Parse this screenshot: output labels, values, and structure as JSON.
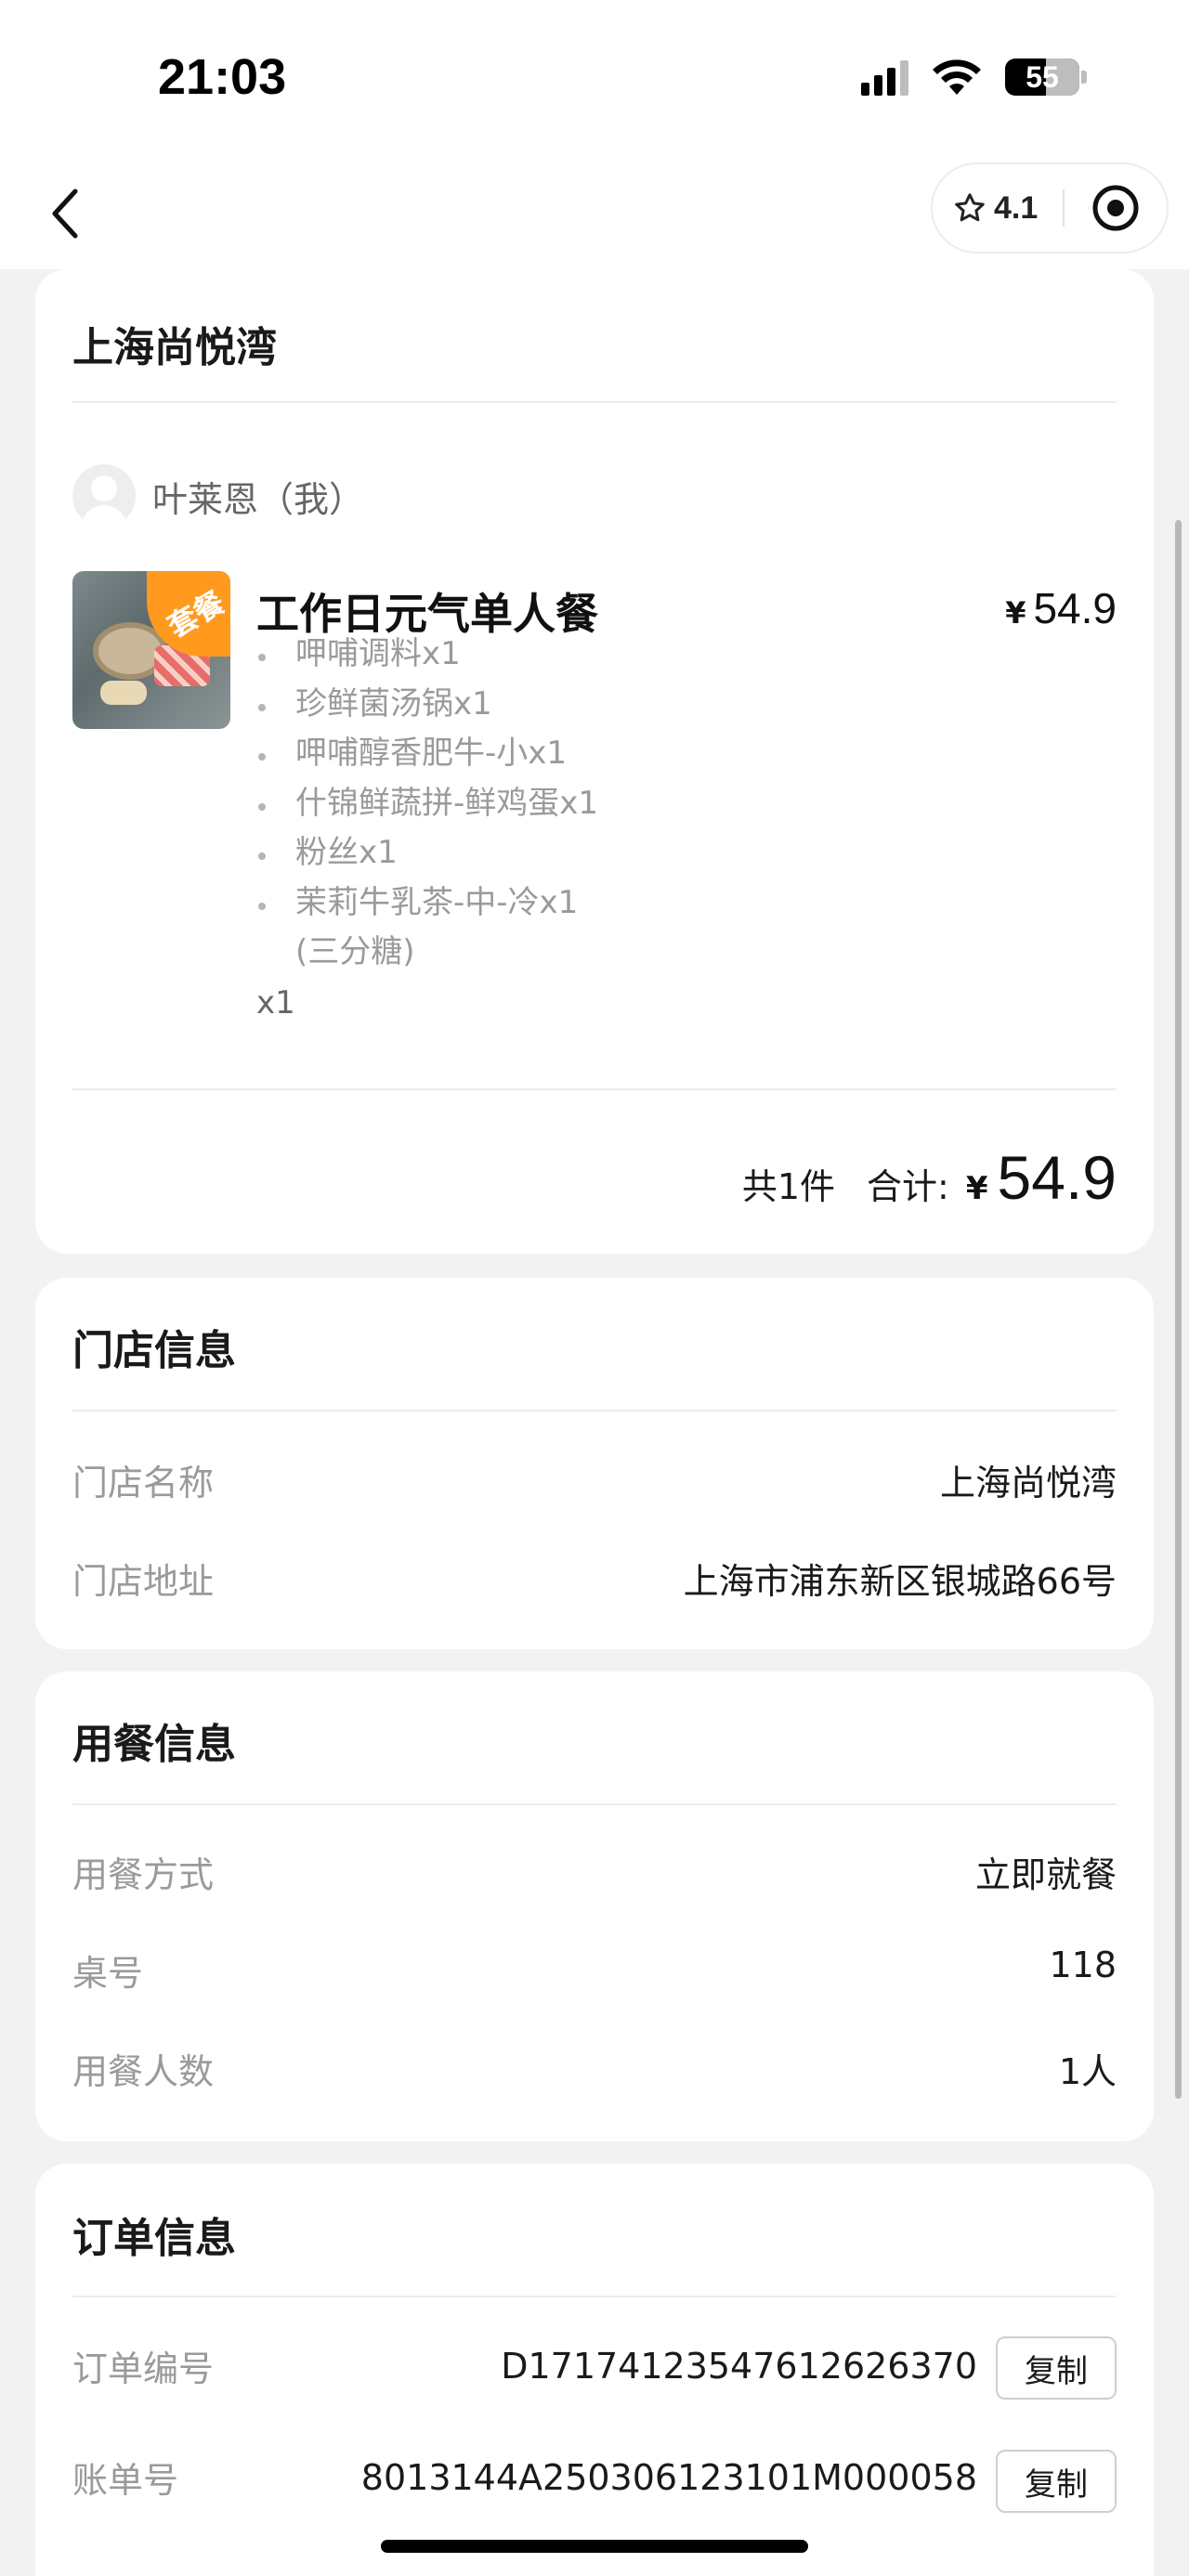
{
  "status_bar": {
    "time": "21:03",
    "battery": "55"
  },
  "nav": {
    "rating": "4.1",
    "back_icon": "chevron-left-icon",
    "star_icon": "star-outline-icon",
    "target_icon": "target-icon"
  },
  "order": {
    "store_title": "上海尚悦湾",
    "user": "叶莱恩（我）",
    "product": {
      "badge": "套餐",
      "name": "工作日元气单人餐",
      "currency": "¥",
      "price": "54.9",
      "items": [
        "呷哺调料x1",
        "珍鲜菌汤锅x1",
        "呷哺醇香肥牛-小x1",
        "什锦鲜蔬拼-鲜鸡蛋x1",
        "粉丝x1",
        "茉莉牛乳茶-中-冷x1"
      ],
      "last_item_note": "(三分糖)",
      "quantity": "x1"
    },
    "total": {
      "count": "共1件",
      "label": "合计:",
      "currency": "¥",
      "amount": "54.9"
    }
  },
  "store_info": {
    "title": "门店信息",
    "rows": [
      {
        "label": "门店名称",
        "value": "上海尚悦湾"
      },
      {
        "label": "门店地址",
        "value": "上海市浦东新区银城路66号"
      }
    ]
  },
  "dining_info": {
    "title": "用餐信息",
    "rows": [
      {
        "label": "用餐方式",
        "value": "立即就餐"
      },
      {
        "label": "桌号",
        "value": "118"
      },
      {
        "label": "用餐人数",
        "value": "1人"
      }
    ]
  },
  "order_info": {
    "title": "订单信息",
    "copy_label": "复制",
    "rows": [
      {
        "label": "订单编号",
        "value": "D17174123547612626370"
      },
      {
        "label": "账单号",
        "value": "8013144A250306123101M000058"
      }
    ]
  }
}
